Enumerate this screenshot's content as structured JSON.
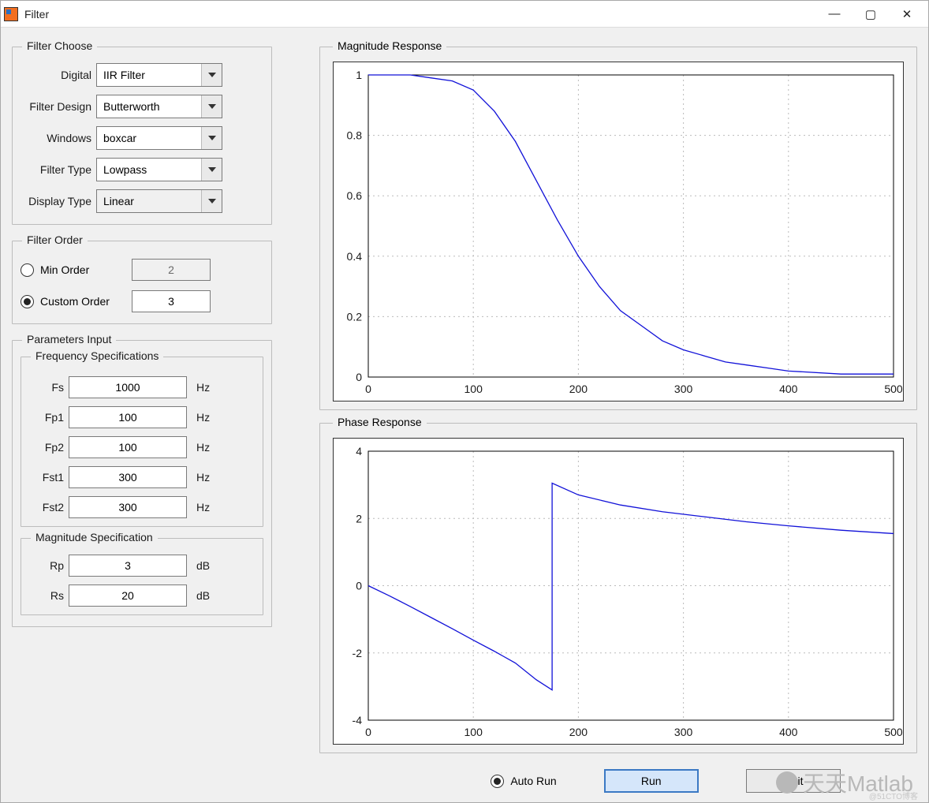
{
  "window": {
    "title": "Filter"
  },
  "winbuttons": {
    "min": "—",
    "max": "▢",
    "close": "✕"
  },
  "filter_choose": {
    "legend": "Filter Choose",
    "rows": {
      "digital": {
        "label": "Digital",
        "value": "IIR Filter"
      },
      "design": {
        "label": "Filter Design",
        "value": "Butterworth"
      },
      "windows": {
        "label": "Windows",
        "value": "boxcar"
      },
      "ftype": {
        "label": "Filter Type",
        "value": "Lowpass"
      },
      "dtype": {
        "label": "Display Type",
        "value": "Linear"
      }
    }
  },
  "filter_order": {
    "legend": "Filter Order",
    "min_label": "Min Order",
    "custom_label": "Custom Order",
    "min_value": "2",
    "custom_value": "3",
    "selected": "custom"
  },
  "params": {
    "legend": "Parameters Input",
    "freq": {
      "legend": "Frequency Specifications",
      "rows": [
        {
          "label": "Fs",
          "value": "1000",
          "unit": "Hz"
        },
        {
          "label": "Fp1",
          "value": "100",
          "unit": "Hz"
        },
        {
          "label": "Fp2",
          "value": "100",
          "unit": "Hz"
        },
        {
          "label": "Fst1",
          "value": "300",
          "unit": "Hz"
        },
        {
          "label": "Fst2",
          "value": "300",
          "unit": "Hz"
        }
      ]
    },
    "mag": {
      "legend": "Magnitude Specification",
      "rows": [
        {
          "label": "Rp",
          "value": "3",
          "unit": "dB"
        },
        {
          "label": "Rs",
          "value": "20",
          "unit": "dB"
        }
      ]
    }
  },
  "buttons": {
    "autorun": "Auto Run",
    "run": "Run",
    "quit": "Quit"
  },
  "watermark": "天天Matlab",
  "microtext": "@51CTO博客",
  "chart_data": [
    {
      "type": "line",
      "title": "Magnitude Response",
      "xlabel": "",
      "ylabel": "",
      "xlim": [
        0,
        500
      ],
      "ylim": [
        0,
        1
      ],
      "xticks": [
        0,
        100,
        200,
        300,
        400,
        500
      ],
      "yticks": [
        0,
        0.2,
        0.4,
        0.6,
        0.8,
        1
      ],
      "grid": true,
      "series": [
        {
          "name": "magnitude",
          "x": [
            0,
            20,
            40,
            60,
            80,
            100,
            120,
            140,
            160,
            180,
            200,
            220,
            240,
            260,
            280,
            300,
            320,
            340,
            360,
            380,
            400,
            450,
            500
          ],
          "values": [
            1.0,
            1.0,
            1.0,
            0.99,
            0.98,
            0.95,
            0.88,
            0.78,
            0.65,
            0.52,
            0.4,
            0.3,
            0.22,
            0.17,
            0.12,
            0.09,
            0.07,
            0.05,
            0.04,
            0.03,
            0.02,
            0.01,
            0.01
          ]
        }
      ]
    },
    {
      "type": "line",
      "title": "Phase  Response",
      "xlabel": "",
      "ylabel": "",
      "xlim": [
        0,
        500
      ],
      "ylim": [
        -4,
        4
      ],
      "xticks": [
        0,
        100,
        200,
        300,
        400,
        500
      ],
      "yticks": [
        -4,
        -2,
        0,
        2,
        4
      ],
      "grid": true,
      "series": [
        {
          "name": "phase",
          "x": [
            0,
            20,
            40,
            60,
            80,
            100,
            120,
            140,
            160,
            175,
            175,
            200,
            240,
            280,
            320,
            360,
            400,
            450,
            500
          ],
          "values": [
            0.0,
            -0.3,
            -0.62,
            -0.95,
            -1.28,
            -1.62,
            -1.95,
            -2.3,
            -2.8,
            -3.1,
            3.05,
            2.7,
            2.4,
            2.2,
            2.05,
            1.9,
            1.78,
            1.65,
            1.55
          ]
        }
      ]
    }
  ]
}
